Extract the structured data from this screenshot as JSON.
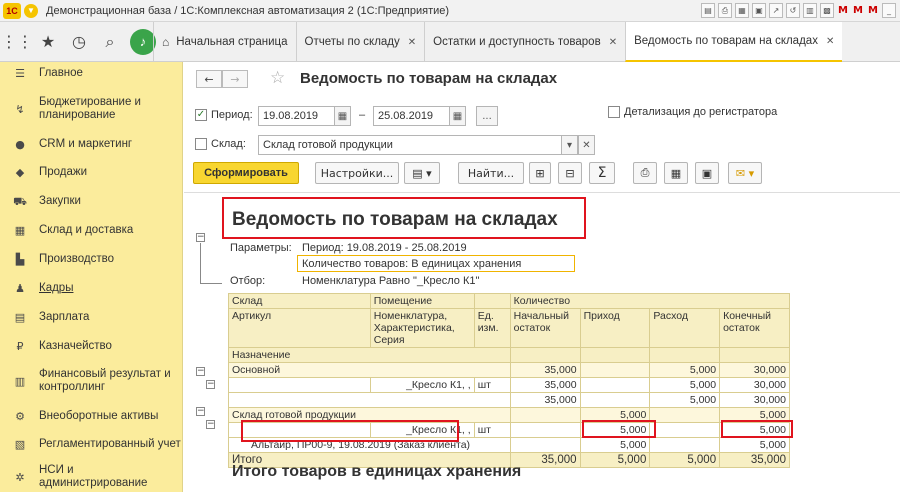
{
  "window": {
    "title": "Демонстрационная база / 1С:Комплексная автоматизация 2  (1С:Предприятие)",
    "logo": "1С"
  },
  "tabs": [
    {
      "label": "Начальная страница",
      "closable": false
    },
    {
      "label": "Отчеты по складу",
      "closable": true
    },
    {
      "label": "Остатки и доступность товаров",
      "closable": true
    },
    {
      "label": "Ведомость по товарам на складах",
      "closable": true,
      "active": true
    }
  ],
  "sidebar": {
    "items": [
      {
        "label": "Главное",
        "icon": "menu-lines-icon"
      },
      {
        "label": "Бюджетирование и планирование",
        "icon": "budget-icon"
      },
      {
        "label": "CRM и маркетинг",
        "icon": "crm-icon"
      },
      {
        "label": "Продажи",
        "icon": "sales-bag-icon"
      },
      {
        "label": "Закупки",
        "icon": "cart-icon"
      },
      {
        "label": "Склад и доставка",
        "icon": "warehouse-icon"
      },
      {
        "label": "Производство",
        "icon": "factory-icon"
      },
      {
        "label": "Кадры",
        "icon": "person-icon"
      },
      {
        "label": "Зарплата",
        "icon": "salary-icon"
      },
      {
        "label": "Казначейство",
        "icon": "ruble-icon"
      },
      {
        "label": "Финансовый результат и контроллинг",
        "icon": "finance-icon"
      },
      {
        "label": "Внеоборотные активы",
        "icon": "assets-icon"
      },
      {
        "label": "Регламентированный учет",
        "icon": "accounting-icon"
      },
      {
        "label": "НСИ и администрирование",
        "icon": "gear-icon"
      }
    ]
  },
  "form": {
    "title": "Ведомость по товарам на складах",
    "period_label": "Период:",
    "period_from": "19.08.2019",
    "period_dash": "–",
    "period_to": "25.08.2019",
    "ellipsis": "...",
    "detail_label": "Детализация до регистратора",
    "warehouse_label": "Склад:",
    "warehouse_value": "Склад готовой продукции",
    "generate_label": "Сформировать",
    "settings_label": "Настройки...",
    "find_label": "Найти...",
    "sum_label": "Σ"
  },
  "report": {
    "title": "Ведомость по товарам на складах",
    "params_label": "Параметры:",
    "params_period": "Период: 19.08.2019 - 25.08.2019",
    "params_qty": "Количество товаров: В единицах хранения",
    "filter_label": "Отбор:",
    "filter_value": "Номенклатура Равно \"_Кресло К1\"",
    "headers": {
      "sklad": "Склад",
      "pomeshenie": "Помещение",
      "kolichestvo": "Количество",
      "artikul": "Артикул",
      "nomenklatura": "Номенклатура, Характеристика, Серия",
      "ed": "Ед. изм.",
      "nach": "Начальный остаток",
      "prihod": "Приход",
      "rashod": "Расход",
      "kon": "Конечный остаток",
      "naznachenie": "Назначение"
    },
    "rows": [
      {
        "c1": "Основной",
        "c2": "",
        "c3": "",
        "nach": "35,000",
        "prihod": "",
        "rashod": "5,000",
        "kon": "30,000",
        "type": "grp"
      },
      {
        "c1": "",
        "c2": "_Кресло К1, ,",
        "c3": "шт",
        "nach": "35,000",
        "prihod": "",
        "rashod": "5,000",
        "kon": "30,000",
        "type": "item"
      },
      {
        "c1": "",
        "c2": "",
        "c3": "",
        "nach": "35,000",
        "prihod": "",
        "rashod": "5,000",
        "kon": "30,000",
        "type": "item"
      },
      {
        "c1": "Склад готовой продукции",
        "c2": "",
        "c3": "",
        "nach": "",
        "prihod": "5,000",
        "rashod": "",
        "kon": "5,000",
        "type": "grp"
      },
      {
        "c1": "",
        "c2": "_Кресло К1, ,",
        "c3": "шт",
        "nach": "",
        "prihod": "5,000",
        "rashod": "",
        "kon": "5,000",
        "type": "item"
      },
      {
        "c1": "Альтаир, ПР00-9, 19.08.2019 (Заказ клиента)",
        "c2": "",
        "c3": "",
        "nach": "",
        "prihod": "5,000",
        "rashod": "",
        "kon": "5,000",
        "type": "item"
      }
    ],
    "total": {
      "label": "Итого",
      "nach": "35,000",
      "prihod": "5,000",
      "rashod": "5,000",
      "kon": "35,000"
    },
    "subtitle": "Итого товаров в единицах хранения"
  },
  "colors": {
    "sidebar_bg": "#fbec9c",
    "primary_button": "#f8d630",
    "highlight_red": "#e0141e",
    "highlight_orange": "#f0b400",
    "bell_green": "#3aa44a"
  }
}
